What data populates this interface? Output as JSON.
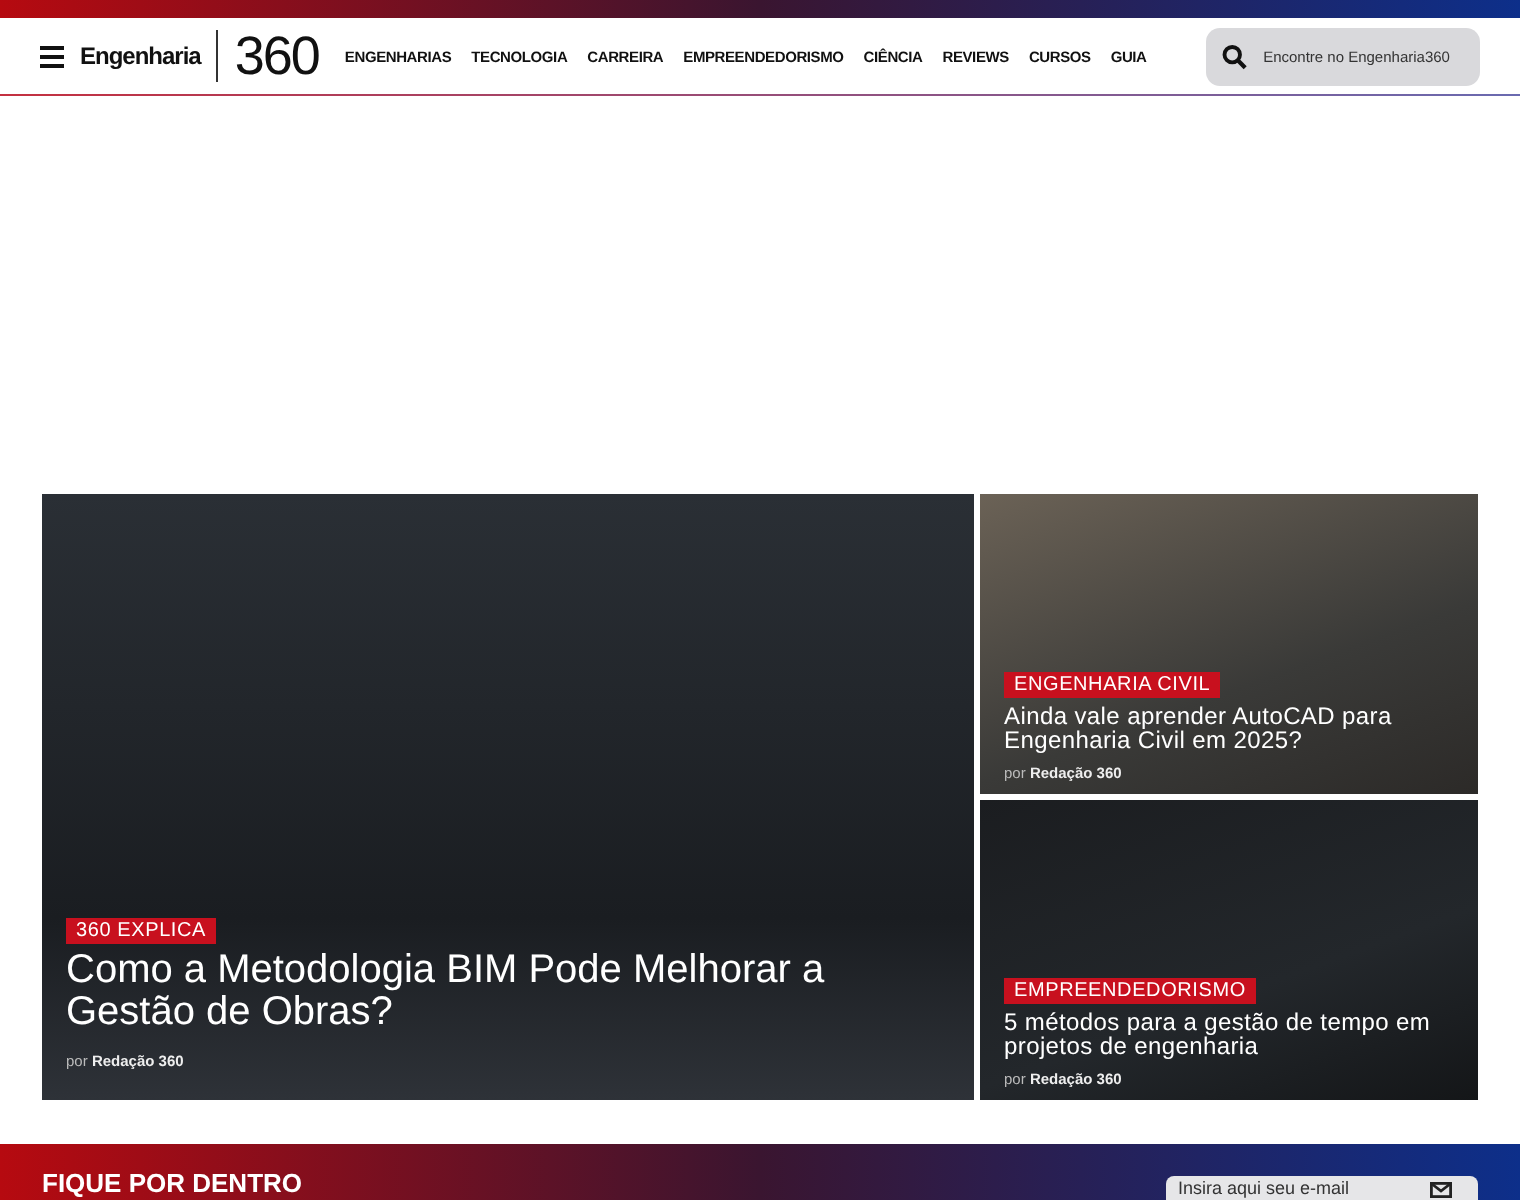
{
  "header": {
    "brand": "Engenharia",
    "logo": "360",
    "nav": [
      "ENGENHARIAS",
      "TECNOLOGIA",
      "CARREIRA",
      "EMPREENDEDORISMO",
      "CIÊNCIA",
      "REVIEWS",
      "CURSOS",
      "GUIA"
    ],
    "search": {
      "placeholder": "Encontre no Engenharia360"
    }
  },
  "featured": [
    {
      "kind": "main",
      "tag": "360 EXPLICA",
      "title": "Como a Metodologia BIM Pode Melhorar a Gestão de Obras?",
      "by": "por",
      "author": "Redação 360"
    },
    {
      "kind": "side",
      "tag": "ENGENHARIA CIVIL",
      "title": "Ainda vale aprender AutoCAD para Engenharia Civil em 2025?",
      "by": "por",
      "author": "Redação 360"
    },
    {
      "kind": "side",
      "tag": "EMPREENDEDORISMO",
      "title": "5 métodos para a gestão de tempo em projetos de engenharia",
      "by": "por",
      "author": "Redação 360"
    }
  ],
  "newsletter": {
    "title": "FIQUE POR DENTRO",
    "placeholder": "Insira aqui seu e-mail"
  }
}
